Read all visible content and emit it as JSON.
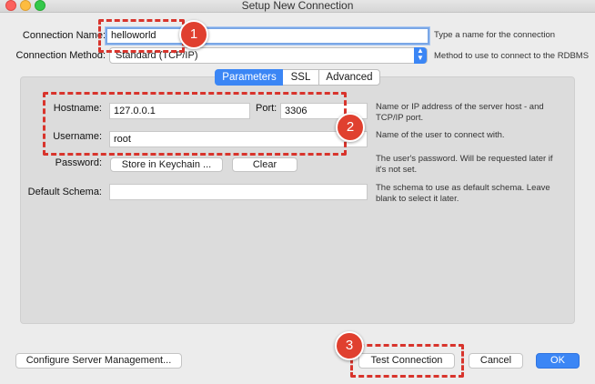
{
  "window": {
    "title": "Setup New Connection"
  },
  "connection_name": {
    "label": "Connection Name:",
    "value": "helloworld",
    "hint": "Type a name for the connection"
  },
  "connection_method": {
    "label": "Connection Method:",
    "value": "Standard (TCP/IP)",
    "hint": "Method to use to connect to the RDBMS"
  },
  "tabs": [
    {
      "label": "Parameters",
      "active": true
    },
    {
      "label": "SSL",
      "active": false
    },
    {
      "label": "Advanced",
      "active": false
    }
  ],
  "params": {
    "hostname": {
      "label": "Hostname:",
      "value": "127.0.0.1"
    },
    "port": {
      "label": "Port:",
      "value": "3306"
    },
    "host_hint": "Name or IP address of the server host - and TCP/IP port.",
    "username": {
      "label": "Username:",
      "value": "root"
    },
    "user_hint": "Name of the user to connect with.",
    "password": {
      "label": "Password:",
      "store_button": "Store in Keychain ...",
      "clear_button": "Clear"
    },
    "password_hint": "The user's password. Will be requested later if it's not set.",
    "schema": {
      "label": "Default Schema:",
      "value": ""
    },
    "schema_hint": "The schema to use as default schema. Leave blank to select it later."
  },
  "footer": {
    "configure_button": "Configure Server Management...",
    "test_button": "Test Connection",
    "cancel_button": "Cancel",
    "ok_button": "OK"
  },
  "callouts": [
    "1",
    "2",
    "3"
  ],
  "colors": {
    "accent": "#3b86f5",
    "callout": "#e0402f",
    "highlight_border": "#d8342c"
  }
}
